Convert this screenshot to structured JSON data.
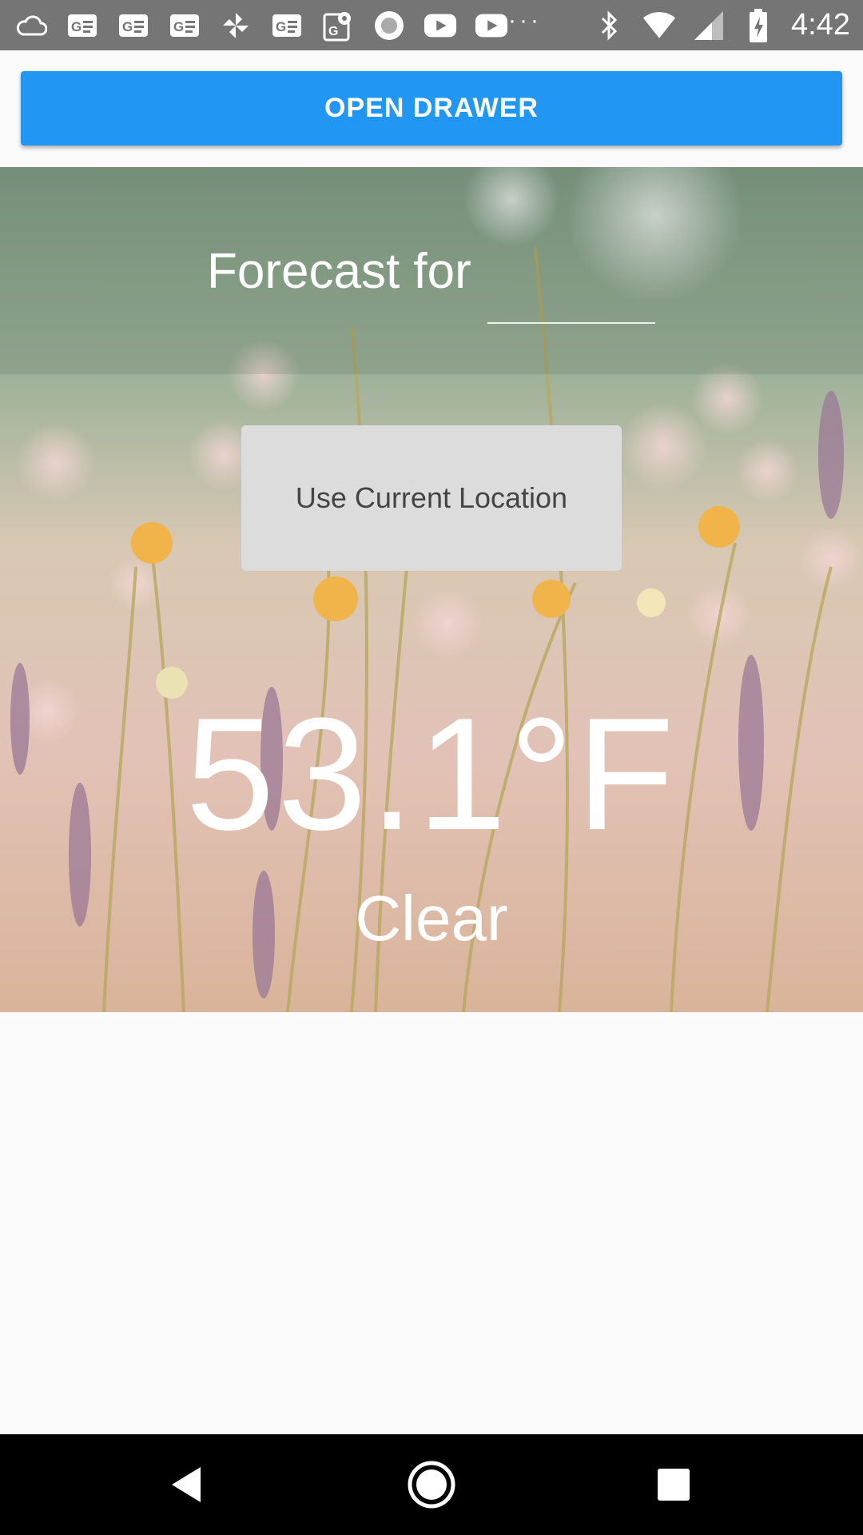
{
  "status_bar": {
    "time": "4:42",
    "overflow_dots": "···",
    "icons": [
      "cloud-icon",
      "news-icon",
      "news-icon",
      "news-icon",
      "pinwheel-icon",
      "news-icon",
      "maps-icon",
      "record-icon",
      "youtube-icon",
      "youtube-icon",
      "bluetooth-icon",
      "wifi-icon",
      "signal-icon",
      "battery-charging-icon"
    ]
  },
  "drawer_button": {
    "label": "OPEN DRAWER"
  },
  "forecast": {
    "label": "Forecast for",
    "input_value": "",
    "input_placeholder": ""
  },
  "location_button": {
    "label": "Use Current Location"
  },
  "weather": {
    "temperature": "53.1°F",
    "condition": "Clear"
  },
  "nav_bar": {
    "icons": [
      "back-icon",
      "home-icon",
      "recents-icon"
    ]
  },
  "colors": {
    "accent": "#2196f3",
    "status_bar": "#757575",
    "location_button_bg": "#dcdcdc",
    "background": "#fafafa"
  }
}
